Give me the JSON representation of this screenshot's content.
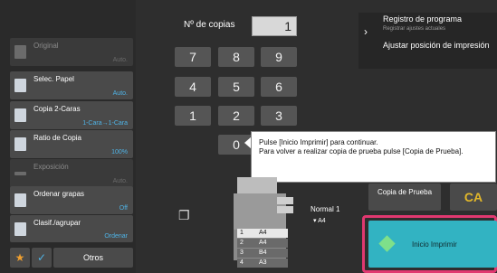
{
  "copies": {
    "label": "Nº de copias",
    "value": "1"
  },
  "keypad": [
    "7",
    "8",
    "9",
    "4",
    "5",
    "6",
    "1",
    "2",
    "3",
    "0"
  ],
  "sidebar": {
    "items": [
      {
        "label": "Original",
        "value": "Auto.",
        "enabled": false
      },
      {
        "label": "Selec. Papel",
        "value": "Auto.",
        "enabled": true
      },
      {
        "label": "Copia 2-Caras",
        "value": "1-Cara→1-Cara",
        "enabled": true
      },
      {
        "label": "Ratio de Copia",
        "value": "100%",
        "enabled": true
      },
      {
        "label": "Exposición",
        "value": "Auto.",
        "enabled": false
      },
      {
        "label": "Ordenar grapas",
        "value": "Off",
        "enabled": true
      },
      {
        "label": "Clasif./agrupar",
        "value": "Ordenar",
        "enabled": true
      }
    ],
    "otros_label": "Otros"
  },
  "right_panel": {
    "program_register": "Registro de programa",
    "program_register_sub": "Registrar ajustes actuales",
    "adjust_position": "Ajustar posición de impresión"
  },
  "tooltip": {
    "line1": "Pulse [Inicio Imprimir] para continuar.",
    "line2": "Para volver a realizar copia de prueba pulse [Copia de Prueba]."
  },
  "machine": {
    "output_mode": "Normal 1",
    "output_paper": "A4",
    "trays": [
      "A4",
      "A4",
      "B4",
      "A3"
    ],
    "tray_numbers": [
      "1",
      "2",
      "3",
      "4"
    ]
  },
  "buttons": {
    "proof_copy": "Copia de Prueba",
    "clear_all": "CA",
    "start_print": "Inicio Imprimir"
  },
  "colors": {
    "accent_blue": "#4fb3e6",
    "start_button": "#32b3c2",
    "highlight": "#e13870",
    "ca_text": "#e3b82a"
  }
}
